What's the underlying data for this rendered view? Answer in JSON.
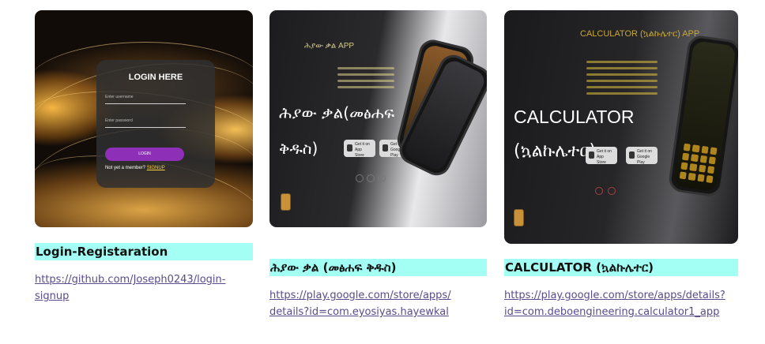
{
  "projects": [
    {
      "title": "Login-Registaration",
      "link_line1": "https://github.com/Joseph0243/login-",
      "link_line2": "signup",
      "thumb": {
        "heading": "LOGIN HERE",
        "username_placeholder": "Enter username",
        "password_placeholder": "Enter password",
        "button": "LOGIN",
        "footer_text": "Not yet a member?",
        "footer_link": "SIGNUP"
      }
    },
    {
      "title": "ሕያው ቃል (መፅሐፍ ቅዱስ)",
      "link_line1": "https://play.google.com/store/apps/",
      "link_line2": "details?id=com.eyosiyas.hayewkal",
      "thumb": {
        "app_label": "ሕያው ቃል APP",
        "big_line1": "ሕያው ቃል(መፅሐፍ",
        "big_line2": "ቅዱስ)",
        "store1": "Get it on App Store",
        "store2": "Get it on Google Play"
      }
    },
    {
      "title": "CALCULATOR (ኳልኩሌተር)",
      "link_line1": "https://play.google.com/store/apps/details?",
      "link_line2": "id=com.deboengineering.calculator1_app",
      "thumb": {
        "app_label": "CALCULATOR (ኳልኩሌተር) APP",
        "big_line1": "CALCULATOR",
        "big_line2": "(ኳልኩሌተር)",
        "store1": "Get it on App Store",
        "store2": "Get it on Google Play"
      }
    }
  ],
  "colors": {
    "caption_bg": "#a3fff4",
    "link": "#5a4b8c"
  }
}
